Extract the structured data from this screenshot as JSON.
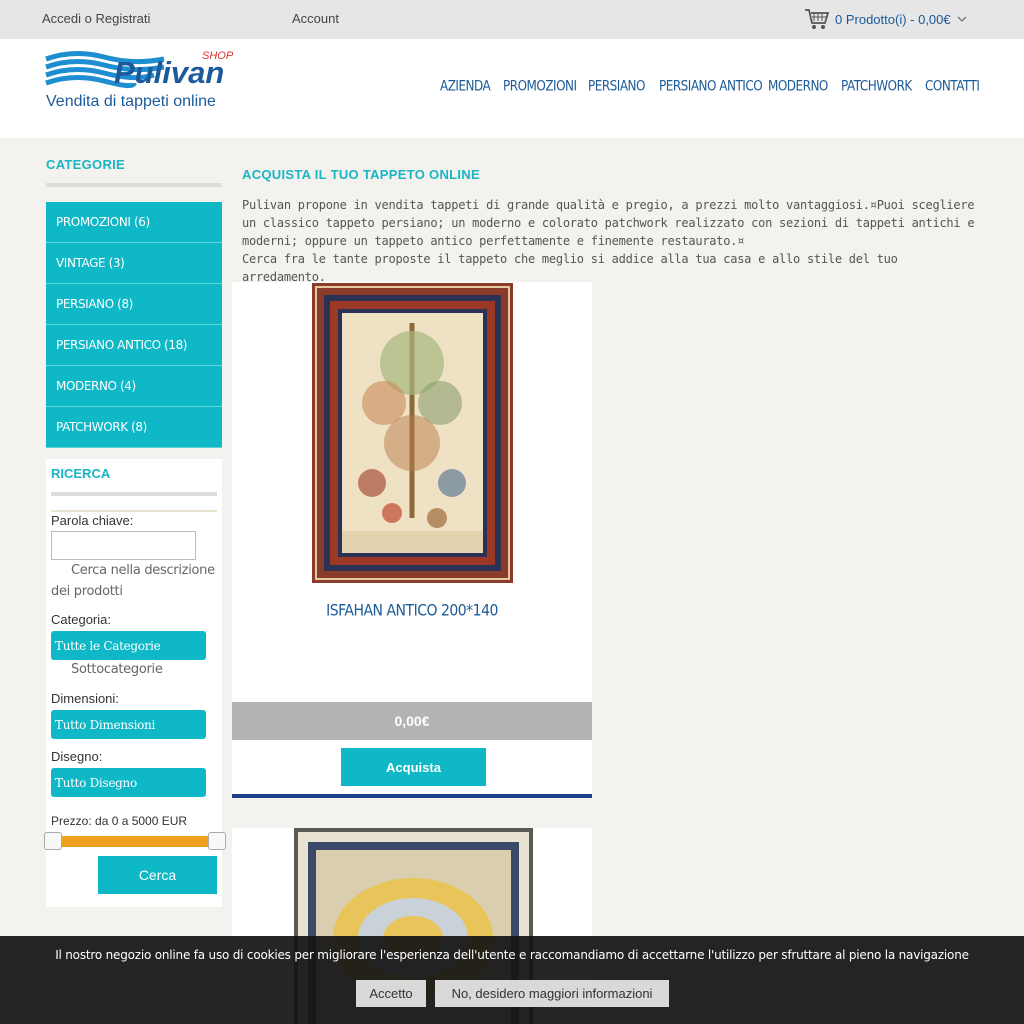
{
  "topbar": {
    "login": "Accedi o Registrati",
    "account": "Account",
    "cart": "0 Prodotto(i) - 0,00€"
  },
  "brand": {
    "name": "Pulivan",
    "shop": "SHOP",
    "tagline": "Vendita di tappeti online"
  },
  "nav": [
    "AZIENDA",
    "PROMOZIONI",
    "PERSIANO",
    "PERSIANO ANTICO",
    "MODERNO",
    "PATCHWORK",
    "CONTATTI"
  ],
  "sidebar": {
    "title": "CATEGORIE",
    "items": [
      "PROMOZIONI (6)",
      "VINTAGE (3)",
      "PERSIANO (8)",
      "PERSIANO ANTICO (18)",
      "MODERNO (4)",
      "PATCHWORK (8)"
    ]
  },
  "search": {
    "title": "RICERCA",
    "keyword_label": "Parola chiave:",
    "keyword_value": "",
    "desc_check": "Cerca nella descrizione dei prodotti",
    "category_label": "Categoria:",
    "category_value": "Tutte le Categorie",
    "subcat_check": "Sottocategorie",
    "dimension_label": "Dimensioni:",
    "dimension_value": "Tutto Dimensioni",
    "design_label": "Disegno:",
    "design_value": "Tutto Disegno",
    "price_label": "Prezzo: da 0 a 5000 EUR",
    "price_min": 0,
    "price_max": 5000,
    "button": "Cerca"
  },
  "main": {
    "title": "ACQUISTA IL TUO TAPPETO ONLINE",
    "intro": "Pulivan propone in vendita tappeti di grande qualità e pregio, a prezzi molto vantaggiosi.¤Puoi scegliere un classico tappeto persiano; un moderno e colorato patchwork realizzato con sezioni di tappeti antichi e moderni; oppure un tappeto antico perfettamente e finemente restaurato.¤",
    "intro2": "Cerca fra le tante proposte il tappeto che meglio si addice alla tua casa e allo stile del tuo arredamento."
  },
  "products": [
    {
      "name": "ISFAHAN ANTICO 200*140",
      "price": "0,00€",
      "button": "Acquista"
    }
  ],
  "cookie": {
    "text": "Il nostro negozio online fa uso di cookies per migliorare l'esperienza dell'utente e raccomandiamo di accettarne l'utilizzo per sfruttare al pieno la navigazione",
    "accept": "Accetto",
    "decline": "No, desidero maggiori informazioni"
  },
  "colors": {
    "accent": "#0fb8c6",
    "brand_blue": "#1b5b98",
    "slider": "#f0a020",
    "price_bg": "#b3b3b3"
  }
}
